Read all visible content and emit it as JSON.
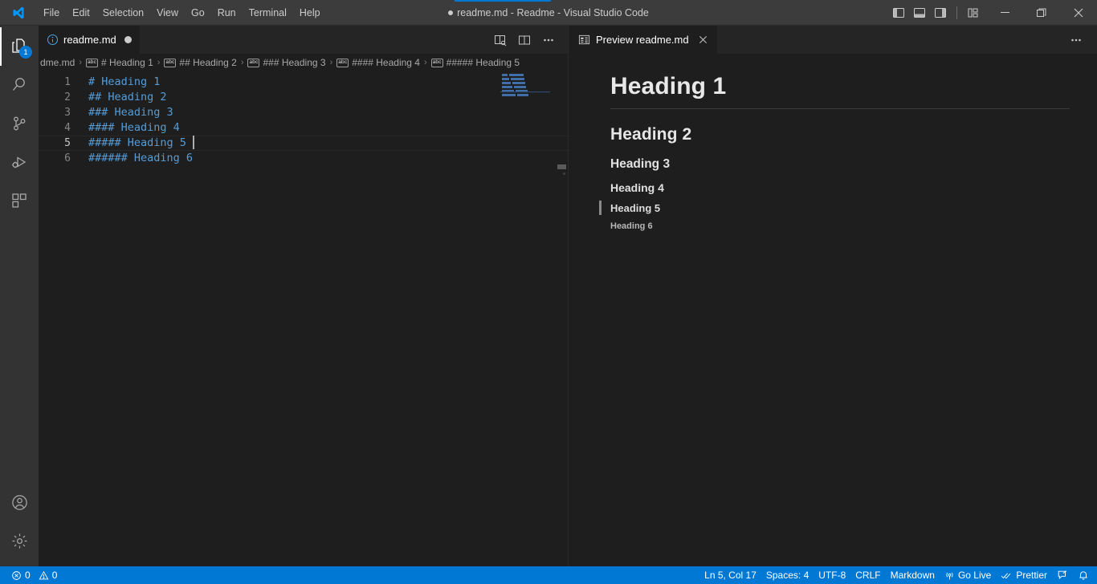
{
  "titlebar": {
    "logo_icon": "vscode-logo-icon",
    "menus": [
      "File",
      "Edit",
      "Selection",
      "View",
      "Go",
      "Run",
      "Terminal",
      "Help"
    ],
    "window_title": "readme.md - Readme - Visual Studio Code",
    "dirty_indicator": "●",
    "layout_buttons": [
      {
        "name": "toggle-primary-sidebar-button",
        "icon": "layout-sidebar-left-icon"
      },
      {
        "name": "toggle-panel-button",
        "icon": "layout-panel-icon"
      },
      {
        "name": "toggle-secondary-sidebar-button",
        "icon": "layout-sidebar-right-icon"
      },
      {
        "name": "customize-layout-button",
        "icon": "layout-customize-icon"
      }
    ],
    "window_controls": [
      {
        "name": "minimize-button",
        "icon": "minimize-icon"
      },
      {
        "name": "maximize-button",
        "icon": "maximize-icon"
      },
      {
        "name": "close-button",
        "icon": "close-icon"
      }
    ]
  },
  "activitybar": {
    "items": [
      {
        "name": "sidebar-item-explorer",
        "icon": "files-icon",
        "active": true,
        "badge": "1"
      },
      {
        "name": "sidebar-item-search",
        "icon": "search-icon",
        "active": false,
        "badge": ""
      },
      {
        "name": "sidebar-item-source-control",
        "icon": "source-control-icon",
        "active": false,
        "badge": ""
      },
      {
        "name": "sidebar-item-run-debug",
        "icon": "run-and-debug-icon",
        "active": false,
        "badge": ""
      },
      {
        "name": "sidebar-item-extensions",
        "icon": "extensions-icon",
        "active": false,
        "badge": ""
      }
    ],
    "bottom_items": [
      {
        "name": "accounts-button",
        "icon": "account-icon"
      },
      {
        "name": "manage-settings-button",
        "icon": "gear-icon"
      }
    ]
  },
  "editor": {
    "tab": {
      "icon": "markdown-preview-info-icon",
      "label": "readme.md",
      "dirty": true
    },
    "tab_actions": [
      {
        "name": "open-preview-to-the-side-button",
        "icon": "open-preview-icon"
      },
      {
        "name": "split-editor-button",
        "icon": "split-editor-icon"
      },
      {
        "name": "more-actions-button",
        "icon": "ellipsis-icon"
      }
    ],
    "breadcrumbs": [
      {
        "icon": "",
        "label": "dme.md"
      },
      {
        "icon": "symbol-string-icon",
        "label": "# Heading 1"
      },
      {
        "icon": "symbol-string-icon",
        "label": "## Heading 2"
      },
      {
        "icon": "symbol-string-icon",
        "label": "### Heading 3"
      },
      {
        "icon": "symbol-string-icon",
        "label": "#### Heading 4"
      },
      {
        "icon": "symbol-string-icon",
        "label": "##### Heading 5"
      }
    ],
    "breadcrumb_separator": "›",
    "lines": [
      {
        "number": "1",
        "text": "# Heading 1",
        "active": false
      },
      {
        "number": "2",
        "text": "## Heading 2",
        "active": false
      },
      {
        "number": "3",
        "text": "### Heading 3",
        "active": false
      },
      {
        "number": "4",
        "text": "#### Heading 4",
        "active": false
      },
      {
        "number": "5",
        "text": "##### Heading 5 ",
        "active": true
      },
      {
        "number": "6",
        "text": "###### Heading 6",
        "active": false
      }
    ],
    "heading_color": "#569cd6",
    "cursor_line": 5
  },
  "preview": {
    "tab": {
      "icon": "preview-icon",
      "label": "Preview readme.md",
      "close_icon": "close-icon"
    },
    "more_actions": {
      "name": "preview-more-actions-button",
      "icon": "ellipsis-icon"
    },
    "headings": [
      {
        "level": 1,
        "text": "Heading 1",
        "marked": false
      },
      {
        "level": 2,
        "text": "Heading 2",
        "marked": false
      },
      {
        "level": 3,
        "text": "Heading 3",
        "marked": false
      },
      {
        "level": 4,
        "text": "Heading 4",
        "marked": false
      },
      {
        "level": 5,
        "text": "Heading 5",
        "marked": true
      },
      {
        "level": 6,
        "text": "Heading 6",
        "marked": false
      }
    ]
  },
  "statusbar": {
    "background": "#0078d4",
    "left": [
      {
        "name": "status-problems",
        "icons": [
          "error-icon",
          "warning-icon"
        ],
        "error_count": "0",
        "warning_count": "0"
      }
    ],
    "right": [
      {
        "name": "status-cursor-position",
        "label": "Ln 5, Col 17",
        "icon": ""
      },
      {
        "name": "status-indentation",
        "label": "Spaces: 4",
        "icon": ""
      },
      {
        "name": "status-encoding",
        "label": "UTF-8",
        "icon": ""
      },
      {
        "name": "status-eol",
        "label": "CRLF",
        "icon": ""
      },
      {
        "name": "status-language-mode",
        "label": "Markdown",
        "icon": ""
      },
      {
        "name": "status-go-live",
        "label": "Go Live",
        "icon": "broadcast-icon"
      },
      {
        "name": "status-prettier",
        "label": "Prettier",
        "icon": "check-all-icon"
      },
      {
        "name": "status-feedback",
        "label": "",
        "icon": "feedback-icon"
      },
      {
        "name": "status-notifications",
        "label": "",
        "icon": "bell-icon"
      }
    ]
  }
}
